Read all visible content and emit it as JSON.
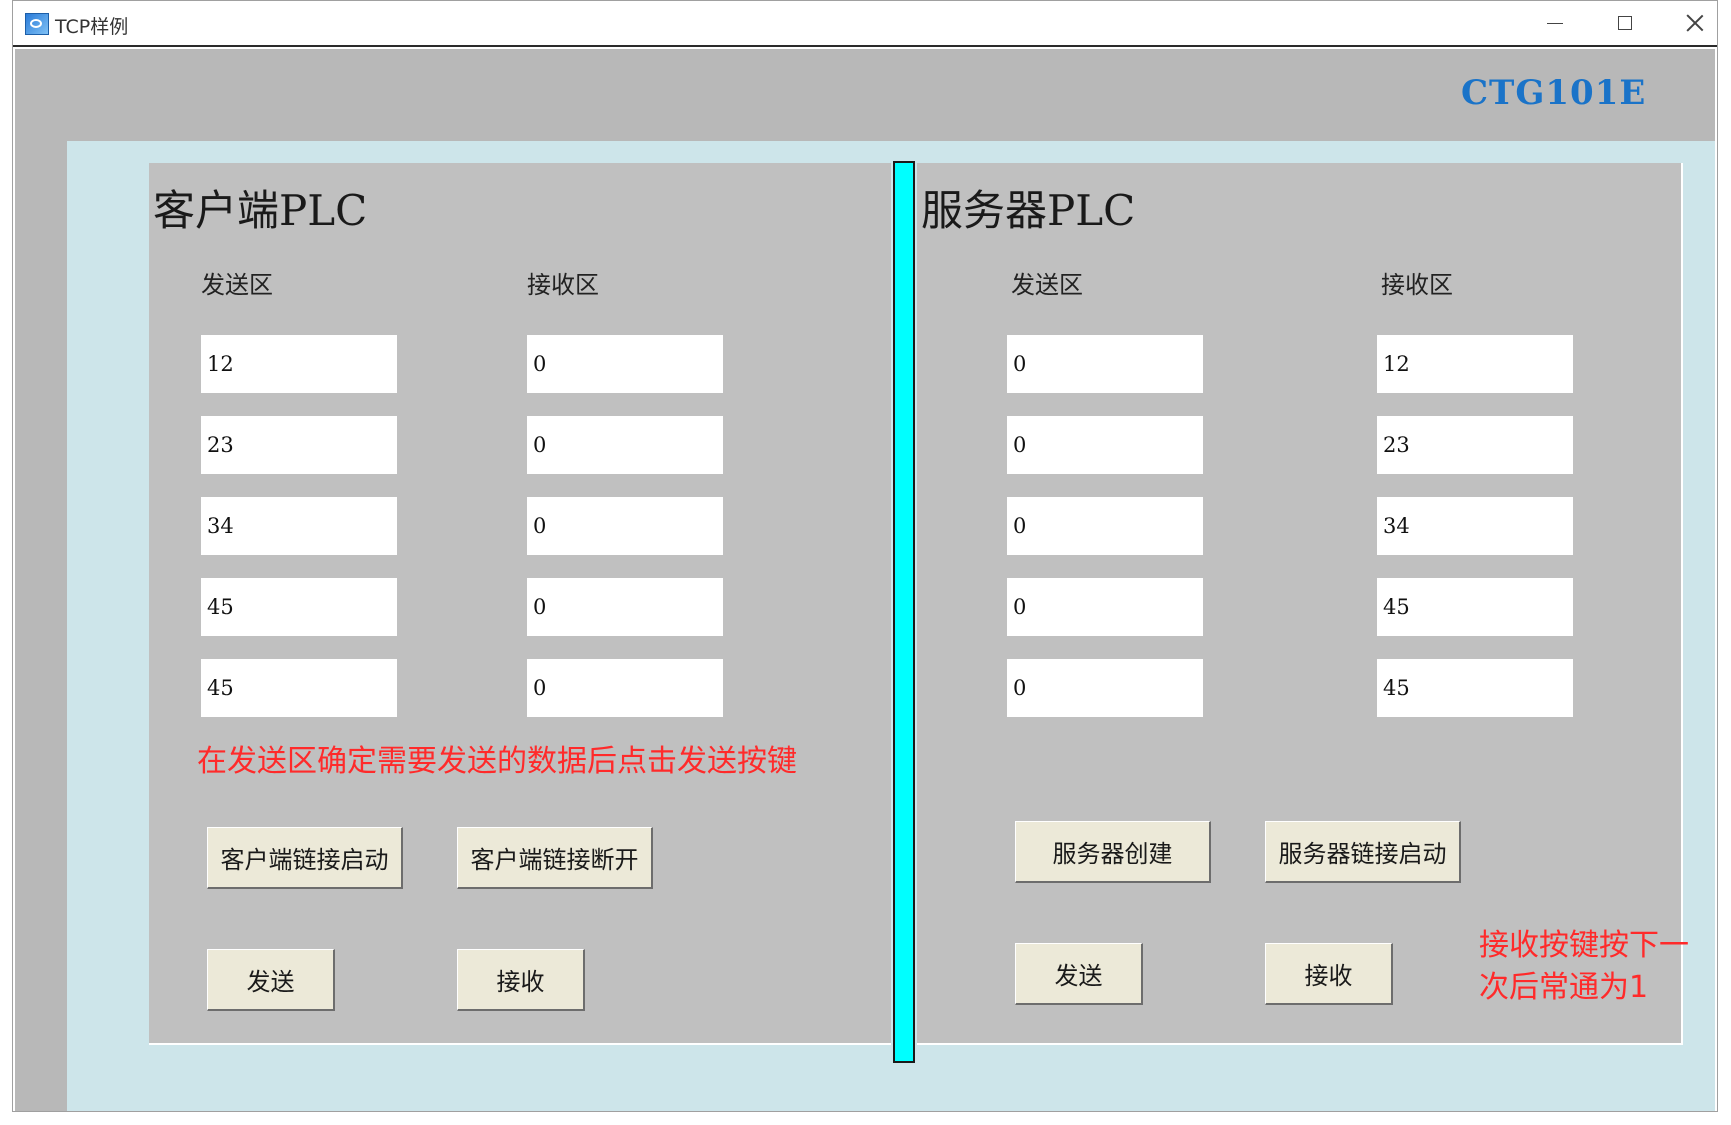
{
  "window": {
    "title": "TCP样例"
  },
  "brand": "CTG101E",
  "client": {
    "title": "客户端PLC",
    "send_label": "发送区",
    "recv_label": "接收区",
    "send_values": [
      "12",
      "23",
      "34",
      "45",
      "45"
    ],
    "recv_values": [
      "0",
      "0",
      "0",
      "0",
      "0"
    ],
    "note": "在发送区确定需要发送的数据后点击发送按键",
    "buttons": {
      "connect": "客户端链接启动",
      "disconnect": "客户端链接断开",
      "send": "发送",
      "receive": "接收"
    }
  },
  "server": {
    "title": "服务器PLC",
    "send_label": "发送区",
    "recv_label": "接收区",
    "send_values": [
      "0",
      "0",
      "0",
      "0",
      "0"
    ],
    "recv_values": [
      "12",
      "23",
      "34",
      "45",
      "45"
    ],
    "note_line1": "接收按键按下一",
    "note_line2": "次后常通为1",
    "buttons": {
      "create": "服务器创建",
      "connect": "服务器链接启动",
      "send": "发送",
      "receive": "接收"
    }
  },
  "colors": {
    "accent_divider": "#00ffff",
    "brand": "#1a73c8",
    "note": "#ff2a2a",
    "panel": "#c0c0c0",
    "frame": "#cde5ea"
  }
}
